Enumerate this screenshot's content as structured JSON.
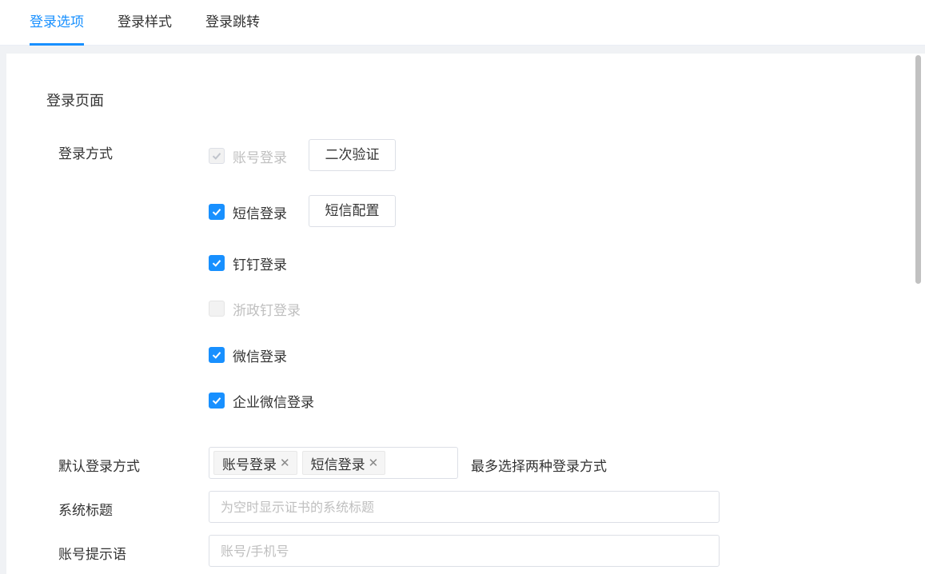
{
  "tabs": [
    {
      "label": "登录选项",
      "active": true
    },
    {
      "label": "登录样式",
      "active": false
    },
    {
      "label": "登录跳转",
      "active": false
    }
  ],
  "section_title": "登录页面",
  "login_methods": {
    "label": "登录方式",
    "options": [
      {
        "label": "账号登录",
        "checked": true,
        "disabled": true,
        "button": "二次验证"
      },
      {
        "label": "短信登录",
        "checked": true,
        "disabled": false,
        "button": "短信配置"
      },
      {
        "label": "钉钉登录",
        "checked": true,
        "disabled": false
      },
      {
        "label": "浙政钉登录",
        "checked": false,
        "disabled": true
      },
      {
        "label": "微信登录",
        "checked": true,
        "disabled": false
      },
      {
        "label": "企业微信登录",
        "checked": true,
        "disabled": false
      }
    ]
  },
  "default_login": {
    "label": "默认登录方式",
    "tags": [
      "账号登录",
      "短信登录"
    ],
    "hint": "最多选择两种登录方式"
  },
  "system_title": {
    "label": "系统标题",
    "value": "",
    "placeholder": "为空时显示证书的系统标题"
  },
  "account_hint": {
    "label": "账号提示语",
    "value": "",
    "placeholder": "账号/手机号"
  },
  "colors": {
    "primary": "#1890ff",
    "border": "#dcdfe6",
    "disabled_text": "#bfbfbf"
  },
  "icons": {
    "check": "check-icon",
    "tag_close": "close-icon"
  }
}
